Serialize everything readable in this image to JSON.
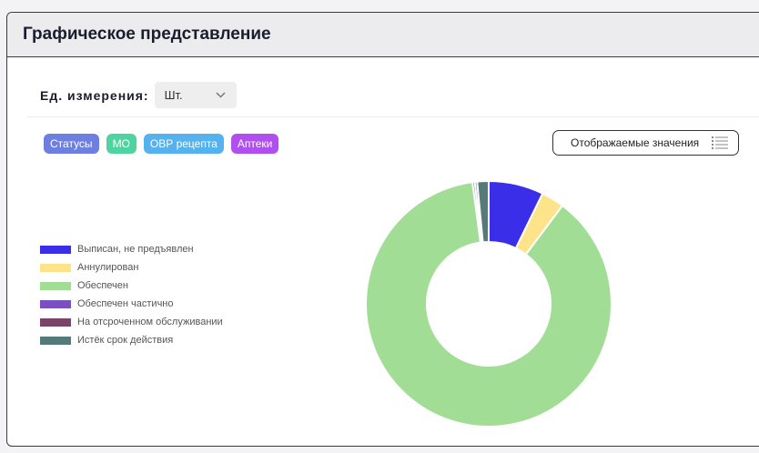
{
  "header": {
    "title": "Графическое представление"
  },
  "units": {
    "label": "Ед. измерения:",
    "selected": "Шт."
  },
  "filters": [
    {
      "label": "Статусы",
      "color": "#6d7fe0"
    },
    {
      "label": "МО",
      "color": "#4fd3a0"
    },
    {
      "label": "ОВР рецепта",
      "color": "#55b2ee"
    },
    {
      "label": "Аптеки",
      "color": "#b04ef0"
    }
  ],
  "values_button": {
    "label": "Отображаемые значения",
    "icon": "list-icon"
  },
  "colors": {
    "issued": "#3a2ee8",
    "cancelled": "#fde38a",
    "fulfilled": "#a2dd96",
    "partial": "#7a4fc4",
    "deferred": "#7a4468",
    "expired": "#557a7a"
  },
  "chart_data": {
    "type": "pie",
    "donut": true,
    "legend_position": "left",
    "labels": [
      "Выписан, не предъявлен",
      "Аннулирован",
      "Обеспечен",
      "Обеспечен частично",
      "На отсроченном обслуживании",
      "Истёк срок действия"
    ],
    "values": [
      7.2,
      3.0,
      87.2,
      0.3,
      0.3,
      1.5
    ],
    "colors": [
      "#3a2ee8",
      "#fde38a",
      "#a2dd96",
      "#7a4fc4",
      "#7a4468",
      "#557a7a"
    ]
  }
}
